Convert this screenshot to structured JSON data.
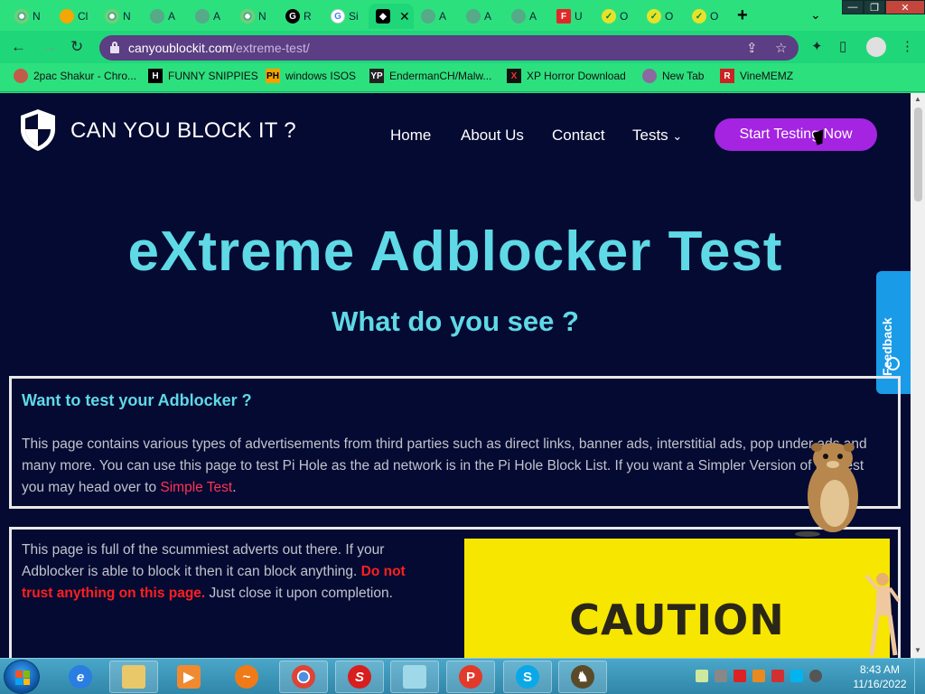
{
  "browser": {
    "tabs": [
      {
        "title": "N",
        "icon": "chrome-icon"
      },
      {
        "title": "Cl",
        "icon": "colab-icon"
      },
      {
        "title": "N",
        "icon": "chrome-icon"
      },
      {
        "title": "A",
        "icon": "globe-icon"
      },
      {
        "title": "A",
        "icon": "globe-icon"
      },
      {
        "title": "N",
        "icon": "chrome-icon"
      },
      {
        "title": "R",
        "icon": "chatgpt-icon"
      },
      {
        "title": "Si",
        "icon": "google-icon"
      },
      {
        "title": "",
        "icon": "shield-icon",
        "active": true
      },
      {
        "title": "A",
        "icon": "globe-icon"
      },
      {
        "title": "A",
        "icon": "globe-icon"
      },
      {
        "title": "A",
        "icon": "globe-icon"
      },
      {
        "title": "U",
        "icon": "flipboard-icon"
      },
      {
        "title": "O",
        "icon": "check-icon"
      },
      {
        "title": "O",
        "icon": "check-icon"
      },
      {
        "title": "O",
        "icon": "check-icon"
      }
    ],
    "url": {
      "host": "canyoublockit.com",
      "path": "/extreme-test/"
    },
    "bookmarks": [
      {
        "label": "2pac Shakur - Chro...",
        "icon": "avatar-icon",
        "color": "#c25b4a"
      },
      {
        "label": "FUNNY SNIPPIES",
        "icon": "h-logo-icon",
        "color": "#000000"
      },
      {
        "label": "windows ISOS",
        "icon": "ph-logo-icon",
        "color": "#f2a100"
      },
      {
        "label": "EndermanCH/Malw...",
        "icon": "yp-logo-icon",
        "color": "#222222"
      },
      {
        "label": "XP Horror Download",
        "icon": "x-logo-icon",
        "color": "#111111"
      },
      {
        "label": "New Tab",
        "icon": "newtab-icon",
        "color": "#8a6aa0"
      },
      {
        "label": "VineMEMZ",
        "icon": "r-logo-icon",
        "color": "#cc2222"
      }
    ]
  },
  "site": {
    "brand": "CAN YOU BLOCK IT ?",
    "nav": {
      "home": "Home",
      "about": "About Us",
      "contact": "Contact",
      "tests": "Tests"
    },
    "cta": "Start Testing Now",
    "title": "eXtreme Adblocker Test",
    "subtitle": "What do you see ?",
    "feedback": "Feedback",
    "box1": {
      "title": "Want to test your Adblocker ?",
      "text": "This page contains various types of advertisements from third parties such as direct links, banner ads, interstitial ads, pop under ads and many more. You can use this page to test Pi Hole as the ad network is in the Pi Hole Block List. If you want a Simpler Version of this test you may head over to ",
      "link": "Simple Test",
      "end": "."
    },
    "box2": {
      "text": "This page is full of the scummiest adverts out there. If your Adblocker is able to block it then it can block anything. ",
      "warning": "Do not trust anything on this page.",
      "text_after": " Just close it upon completion."
    },
    "caution": "CAUTION"
  },
  "taskbar": {
    "time": "8:43 AM",
    "date": "11/16/2022",
    "apps": [
      "ie-icon",
      "explorer-icon",
      "media-player-icon",
      "ucbrowser-icon",
      "chrome-icon",
      "s-app-icon",
      "notepad-icon",
      "puzzle-icon",
      "skype-icon",
      "games-icon"
    ]
  },
  "colors": {
    "page_bg": "#050a32",
    "accent_cyan": "#5fd9e6",
    "cta_purple": "#a424e2",
    "browser_green": "#2de07e",
    "caution_yellow": "#f7e600"
  }
}
